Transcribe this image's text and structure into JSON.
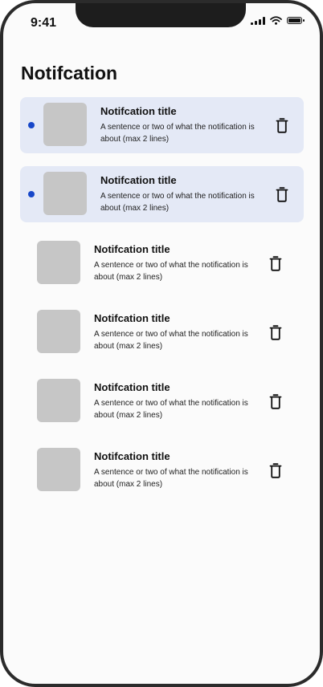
{
  "status_bar": {
    "time": "9:41"
  },
  "header": {
    "title": "Notifcation"
  },
  "notifications": [
    {
      "title": "Notifcation title",
      "body": "A sentence or two of what the notification is about (max 2 lines)",
      "unread": true
    },
    {
      "title": "Notifcation title",
      "body": "A sentence or two of what the notification is about (max 2 lines)",
      "unread": true
    },
    {
      "title": "Notifcation title",
      "body": "A sentence or two of what the notification is about (max 2 lines)",
      "unread": false
    },
    {
      "title": "Notifcation title",
      "body": "A sentence or two of what the notification is about (max 2 lines)",
      "unread": false
    },
    {
      "title": "Notifcation title",
      "body": "A sentence or two of what the notification is about (max 2 lines)",
      "unread": false
    },
    {
      "title": "Notifcation title",
      "body": "A sentence or two of what the notification is about (max 2 lines)",
      "unread": false
    }
  ],
  "icons": {
    "unread": "unread-dot-icon",
    "delete": "trash-icon",
    "thumbnail": "thumbnail-placeholder"
  },
  "colors": {
    "unread_background": "#e4e9f6",
    "unread_dot": "#1747c9",
    "thumbnail": "#c6c6c6"
  }
}
